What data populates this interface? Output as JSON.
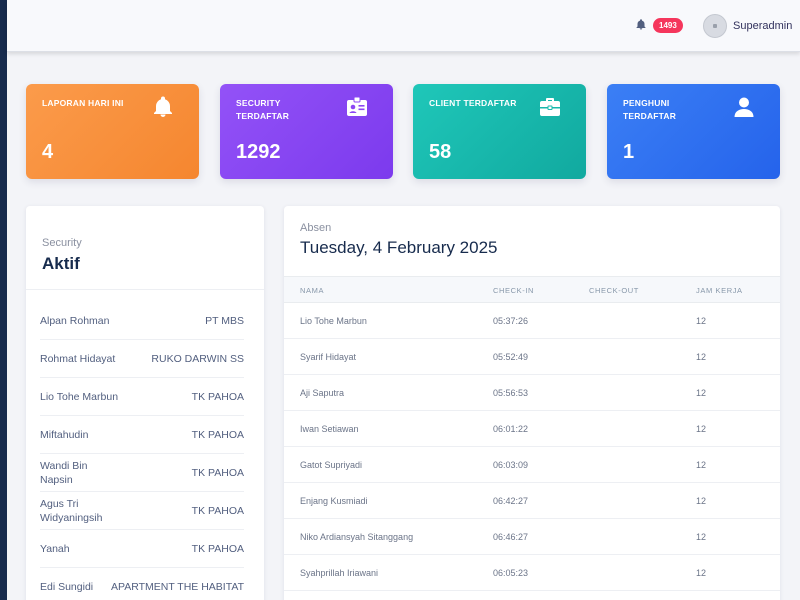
{
  "header": {
    "notification_count": "1493",
    "username": "Superadmin"
  },
  "stats": [
    {
      "label": "LAPORAN HARI INI",
      "value": "4",
      "icon": "bell-icon",
      "color": "#f5862f"
    },
    {
      "label": "SECURITY TERDAFTAR",
      "value": "1292",
      "icon": "id-badge-icon",
      "color": "#7c3aed"
    },
    {
      "label": "CLIENT TERDAFTAR",
      "value": "58",
      "icon": "briefcase-icon",
      "color": "#11a99f"
    },
    {
      "label": "PENGHUNI TERDAFTAR",
      "value": "1",
      "icon": "user-icon",
      "color": "#2563eb"
    }
  ],
  "security_panel": {
    "subtitle": "Security",
    "title": "Aktif",
    "items": [
      {
        "name": "Alpan Rohman",
        "location": "PT MBS"
      },
      {
        "name": "Rohmat Hidayat",
        "location": "RUKO DARWIN SS"
      },
      {
        "name": "Lio Tohe Marbun",
        "location": "TK PAHOA"
      },
      {
        "name": "Miftahudin",
        "location": "TK PAHOA"
      },
      {
        "name": "Wandi Bin Napsin",
        "location": "TK PAHOA"
      },
      {
        "name": "Agus Tri Widyaningsih",
        "location": "TK PAHOA"
      },
      {
        "name": "Yanah",
        "location": "TK PAHOA"
      },
      {
        "name": "Edi Sungidi",
        "location": "APARTMENT THE HABITAT"
      }
    ]
  },
  "absen_panel": {
    "subtitle": "Absen",
    "date": "Tuesday, 4 February 2025",
    "columns": [
      "NAMA",
      "CHECK-IN",
      "CHECK-OUT",
      "JAM KERJA"
    ],
    "rows": [
      {
        "nama": "Lio Tohe Marbun",
        "check_in": "05:37:26",
        "check_out": "",
        "jam_kerja": "12"
      },
      {
        "nama": "Syarif Hidayat",
        "check_in": "05:52:49",
        "check_out": "",
        "jam_kerja": "12"
      },
      {
        "nama": "Aji Saputra",
        "check_in": "05:56:53",
        "check_out": "",
        "jam_kerja": "12"
      },
      {
        "nama": "Iwan Setiawan",
        "check_in": "06:01:22",
        "check_out": "",
        "jam_kerja": "12"
      },
      {
        "nama": "Gatot Supriyadi",
        "check_in": "06:03:09",
        "check_out": "",
        "jam_kerja": "12"
      },
      {
        "nama": "Enjang Kusmiadi",
        "check_in": "06:42:27",
        "check_out": "",
        "jam_kerja": "12"
      },
      {
        "nama": "Niko Ardiansyah Sitanggang",
        "check_in": "06:46:27",
        "check_out": "",
        "jam_kerja": "12"
      },
      {
        "nama": "Syahprillah Iriawani",
        "check_in": "06:05:23",
        "check_out": "",
        "jam_kerja": "12"
      }
    ]
  }
}
